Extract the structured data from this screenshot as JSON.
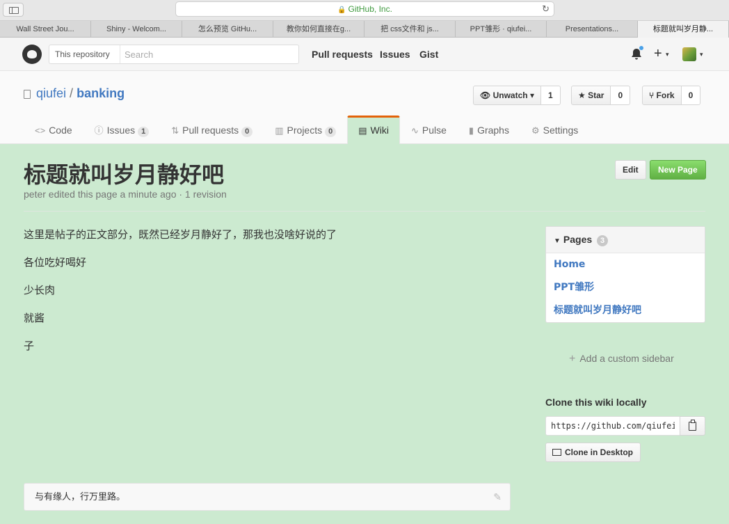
{
  "browser": {
    "url_text": "GitHub, Inc.",
    "tabs": [
      "Wall Street Jou...",
      "Shiny - Welcom...",
      "怎么预览 GitHu...",
      "教你如何直接在g...",
      "把 css文件和 js...",
      "PPT雏形 · qiufei...",
      "Presentations...",
      "标题就叫岁月静..."
    ]
  },
  "header": {
    "scope_label": "This repository",
    "search_placeholder": "Search",
    "nav": {
      "pull_requests": "Pull requests",
      "issues": "Issues",
      "gist": "Gist"
    },
    "plus": "+",
    "caret": "▾"
  },
  "repo": {
    "owner": "qiufei",
    "separator": "/",
    "name": "banking",
    "unwatch_label": "Unwatch",
    "unwatch_count": "1",
    "star_label": "Star",
    "star_count": "0",
    "fork_label": "Fork",
    "fork_count": "0",
    "tabs": {
      "code": "Code",
      "issues": "Issues",
      "issues_count": "1",
      "pull_requests": "Pull requests",
      "pull_requests_count": "0",
      "projects": "Projects",
      "projects_count": "0",
      "wiki": "Wiki",
      "pulse": "Pulse",
      "graphs": "Graphs",
      "settings": "Settings"
    }
  },
  "wiki": {
    "title": "标题就叫岁月静好吧",
    "meta": "peter edited this page a minute ago · 1 revision",
    "edit_label": "Edit",
    "new_page_label": "New Page",
    "body": [
      "这里是帖子的正文部分，既然已经岁月静好了，那我也没啥好说的了",
      "各位吃好喝好",
      "少长肉",
      "就酱",
      "子"
    ],
    "footer": "与有缘人，行万里路。"
  },
  "sidebar": {
    "pages_label": "Pages",
    "pages_count": "3",
    "pages": [
      "Home",
      "PPT雏形",
      "标题就叫岁月静好吧"
    ],
    "add_custom_sidebar": "Add a custom sidebar",
    "clone_title": "Clone this wiki locally",
    "clone_url": "https://github.com/qiufei/banking.wiki.git",
    "clone_desktop_label": "Clone in Desktop"
  },
  "colors": {
    "page_background": "#ccead0",
    "link": "#4078c0",
    "new_page_green": "#60b044",
    "selected_tab_accent": "#e36209"
  }
}
